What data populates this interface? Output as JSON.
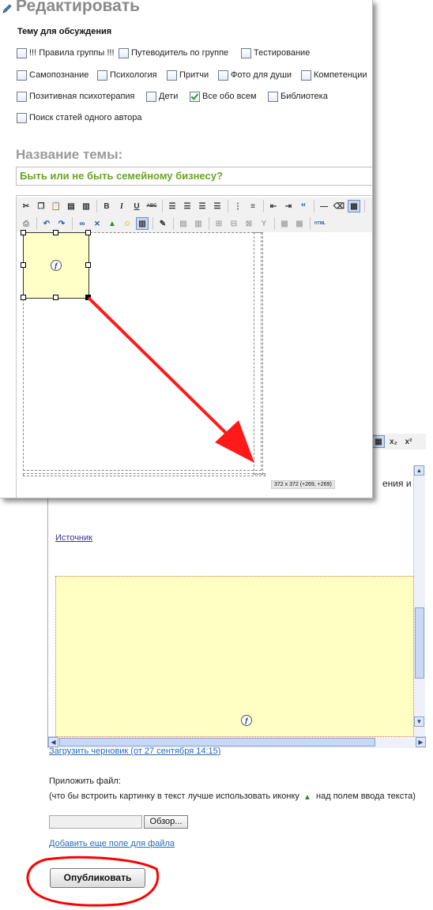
{
  "header": {
    "title": "Редактировать"
  },
  "topics": {
    "label": "Тему для обсуждения",
    "items": [
      {
        "label": "!!! Правила группы !!!",
        "checked": false
      },
      {
        "label": "Путеводитель по группе",
        "checked": false
      },
      {
        "label": "Тестирование",
        "checked": false
      },
      {
        "label": "Самопознание",
        "checked": false
      },
      {
        "label": "Психология",
        "checked": false
      },
      {
        "label": "Притчи",
        "checked": false
      },
      {
        "label": "Фото для души",
        "checked": false
      },
      {
        "label": "Компетенции",
        "checked": false
      },
      {
        "label": "Позитивная психотерапия",
        "checked": false
      },
      {
        "label": "Дети",
        "checked": false
      },
      {
        "label": "Все обо всем",
        "checked": true
      },
      {
        "label": "Библиотека",
        "checked": false
      },
      {
        "label": "Поиск статей одного автора",
        "checked": false
      }
    ]
  },
  "title_field": {
    "label": "Название темы:",
    "value": "Быть или не быть семейному бизнесу?"
  },
  "editor": {
    "toolbar_row1": [
      "cut-icon",
      "copy-icon",
      "paste-icon",
      "paste-text-icon",
      "paste-word-icon",
      "bold",
      "italic",
      "underline",
      "strike",
      "align-left",
      "align-center",
      "align-right",
      "align-justify",
      "bulleted-list",
      "numbered-list",
      "outdent",
      "indent",
      "blockquote",
      "horizontal-rule",
      "eraser",
      "table",
      "remove-format"
    ],
    "toolbar_labels": {
      "bold": "B",
      "italic": "I",
      "underline": "U",
      "strike": "ABC",
      "blockquote": "“",
      "remove": "✕",
      "html": "HTML",
      "sub": "x₂",
      "sup": "x²"
    },
    "size_tooltip": "372 x 372 (+269, +269)"
  },
  "lower_editor": {
    "partial_text": "ения и",
    "source_link": "Источник"
  },
  "footer": {
    "draft_link": "Загрузить черновик (от 27 сентября 14:15)",
    "attach_label": "Приложить файл:",
    "attach_note": "(что бы встроить картинку в текст лучше использовать иконку",
    "attach_note_tail": "над полем ввода текста)",
    "browse_label": "Обзор...",
    "add_field_link": "Добавить еще поле для файла",
    "publish_label": "Опубликовать"
  },
  "colors": {
    "arrow": "#ff1a1a",
    "circle": "#ff0000",
    "title_value": "#6aa51f",
    "link": "#2a6cb0"
  }
}
